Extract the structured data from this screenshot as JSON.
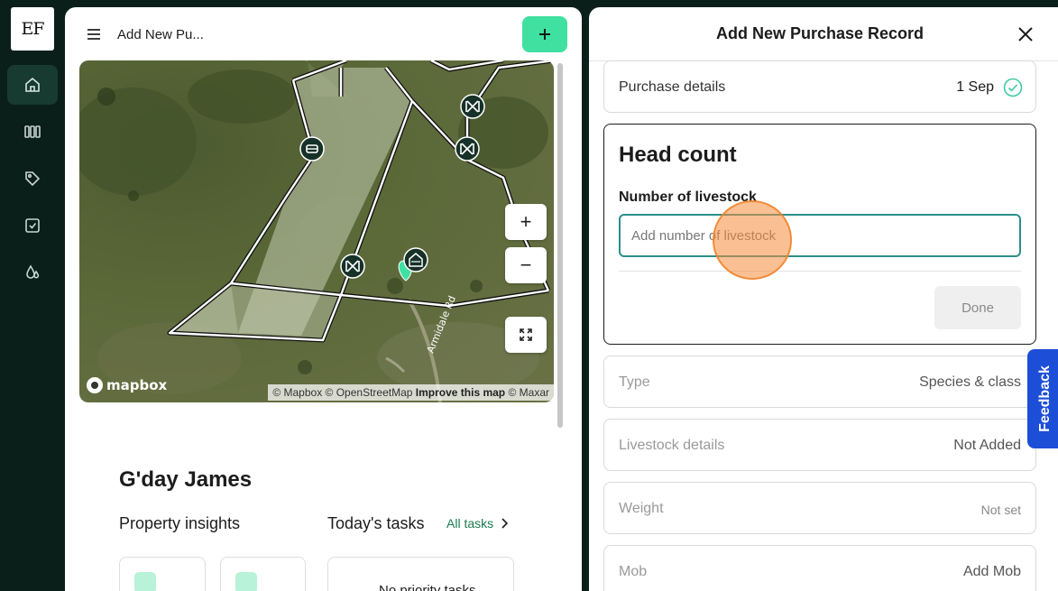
{
  "rail": {
    "logo": "EF",
    "items": [
      {
        "icon": "home-icon",
        "active": true
      },
      {
        "icon": "paddocks-icon",
        "active": false
      },
      {
        "icon": "tag-icon",
        "active": false
      },
      {
        "icon": "task-check-icon",
        "active": false
      },
      {
        "icon": "drops-icon",
        "active": false
      }
    ]
  },
  "dashboard": {
    "title": "Add New Pu...",
    "add_label": "+",
    "map": {
      "zoom_in": "+",
      "zoom_out": "−",
      "mapbox_logo": "mapbox",
      "attribution": {
        "mapbox": "© Mapbox",
        "osm": "© OpenStreetMap",
        "improve": "Improve this map",
        "maxar": "© Maxar"
      },
      "road_label": "Armidale Rd"
    },
    "greeting": "G'day James",
    "insights_heading": "Property insights",
    "tasks_heading": "Today's tasks",
    "all_tasks_link": "All tasks",
    "no_tasks": "No priority tasks"
  },
  "panel": {
    "title": "Add New Purchase Record",
    "purchase_details": {
      "label": "Purchase details",
      "value": "1 Sep"
    },
    "head_count": {
      "title": "Head count",
      "field_label": "Number of livestock",
      "placeholder": "Add number of livestock",
      "done_label": "Done"
    },
    "rows": [
      {
        "label": "Type",
        "value": "Species & class"
      },
      {
        "label": "Livestock details",
        "value": "Not Added"
      },
      {
        "label": "Weight",
        "value": "Not set"
      },
      {
        "label": "Mob",
        "value": "Add Mob"
      }
    ]
  },
  "feedback_label": "Feedback",
  "colors": {
    "rail_bg": "#0b1f1a",
    "accent_green": "#3fe0a0",
    "input_border": "#2a8f8c",
    "feedback_blue": "#1d4ed8"
  }
}
